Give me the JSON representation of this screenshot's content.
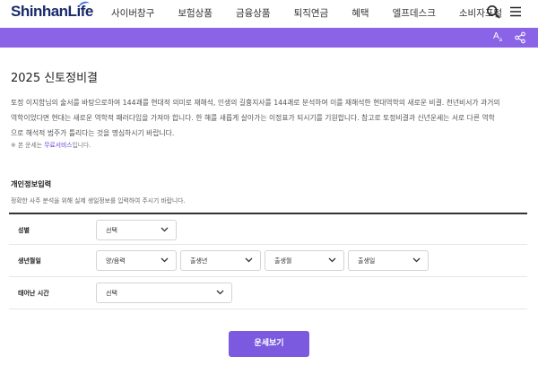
{
  "header": {
    "logo_text": "ShinhanLife",
    "nav": [
      "사이버창구",
      "보험상품",
      "금융상품",
      "퇴직연금",
      "혜택",
      "엘프데스크",
      "소비자포털"
    ]
  },
  "toolbar": {
    "font_size_label": "A",
    "font_size_sub": "a"
  },
  "page": {
    "title": "2025 신토정비결",
    "intro_line1": "토정 이지함님의 술서를 바탕으로하여 144괘를 현대적 의미로 재해석, 인생의 길흉지사를 144괘로 분석하여 이를 재해석한 현대역학의 새로운 비결. 천년비서가 과거의",
    "intro_line2": "역학이었다면 현대는 새로운 역학적 패러다임을 가져야 합니다. 한 해를 새롭게 살아가는 이정표가 되시기를 기원합니다. 참고로 토정비결과 신년운세는 서로 다른 역학",
    "intro_line3": "으로 해석적 범주가 틀리다는 것을 명심하시기 바랍니다.",
    "notice_prefix": "※ 본 운세는 ",
    "notice_link": "무료서비스",
    "notice_suffix": "입니다."
  },
  "form": {
    "section_title": "개인정보입력",
    "section_desc": "정확한 사주 분석을 위해 실제 생일정보를 입력하여 주시기 바랍니다.",
    "rows": [
      {
        "label": "성별",
        "selects": [
          "선택"
        ]
      },
      {
        "label": "생년월일",
        "selects": [
          "양/음력",
          "출생년",
          "출생월",
          "출생일"
        ]
      },
      {
        "label": "태어난 시간",
        "selects": [
          "선택"
        ]
      }
    ],
    "submit_label": "운세보기"
  },
  "colors": {
    "accent": "#8a63e6",
    "button": "#7b5ae0",
    "brand": "#1a2b6b"
  }
}
